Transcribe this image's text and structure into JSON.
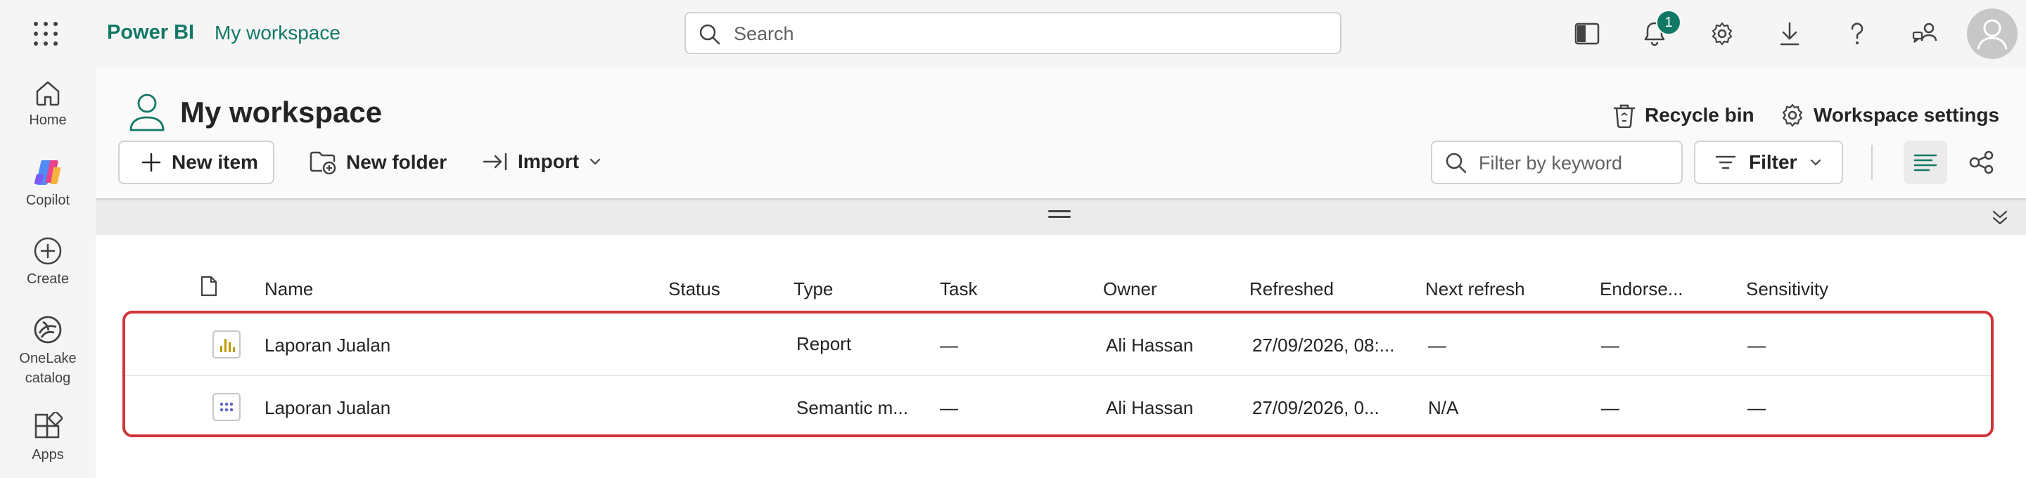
{
  "app": {
    "name": "Power BI",
    "workspace_link": "My workspace",
    "brand_color": "#117865"
  },
  "search": {
    "placeholder": "Search"
  },
  "notifications": {
    "count": "1"
  },
  "topbar_icons": [
    "panel-icon",
    "bell-icon",
    "gear-icon",
    "download-icon",
    "help-icon",
    "share-people-icon",
    "avatar"
  ],
  "rail": {
    "items": [
      {
        "label": "Home",
        "icon": "home-icon"
      },
      {
        "label": "Copilot",
        "icon": "copilot-icon"
      },
      {
        "label": "Create",
        "icon": "create-icon"
      },
      {
        "label": "OneLake catalog",
        "icon": "onelake-icon"
      },
      {
        "label": "Apps",
        "icon": "apps-icon"
      }
    ]
  },
  "workspace": {
    "title": "My workspace",
    "recycle_bin": "Recycle bin",
    "settings": "Workspace settings"
  },
  "toolbar": {
    "new_item": "New item",
    "new_folder": "New folder",
    "import": "Import",
    "filter_placeholder": "Filter by keyword",
    "filter": "Filter"
  },
  "table": {
    "columns": [
      "Name",
      "Status",
      "Type",
      "Task",
      "Owner",
      "Refreshed",
      "Next refresh",
      "Endorse...",
      "Sensitivity"
    ],
    "rows": [
      {
        "icon": "report-icon",
        "name": "Laporan Jualan",
        "status": "",
        "type": "Report",
        "task": "—",
        "owner": "Ali Hassan",
        "refreshed": "27/09/2026, 08:...",
        "next_refresh": "—",
        "endorsement": "—",
        "sensitivity": "—"
      },
      {
        "icon": "semantic-model-icon",
        "name": "Laporan Jualan",
        "status": "",
        "type": "Semantic m...",
        "task": "—",
        "owner": "Ali Hassan",
        "refreshed": "27/09/2026, 0...",
        "next_refresh": "N/A",
        "endorsement": "—",
        "sensitivity": "—"
      }
    ]
  },
  "colors": {
    "highlight_border": "#d13438",
    "report_icon": "#c19c00",
    "semantic_icon": "#5b5fc7"
  }
}
